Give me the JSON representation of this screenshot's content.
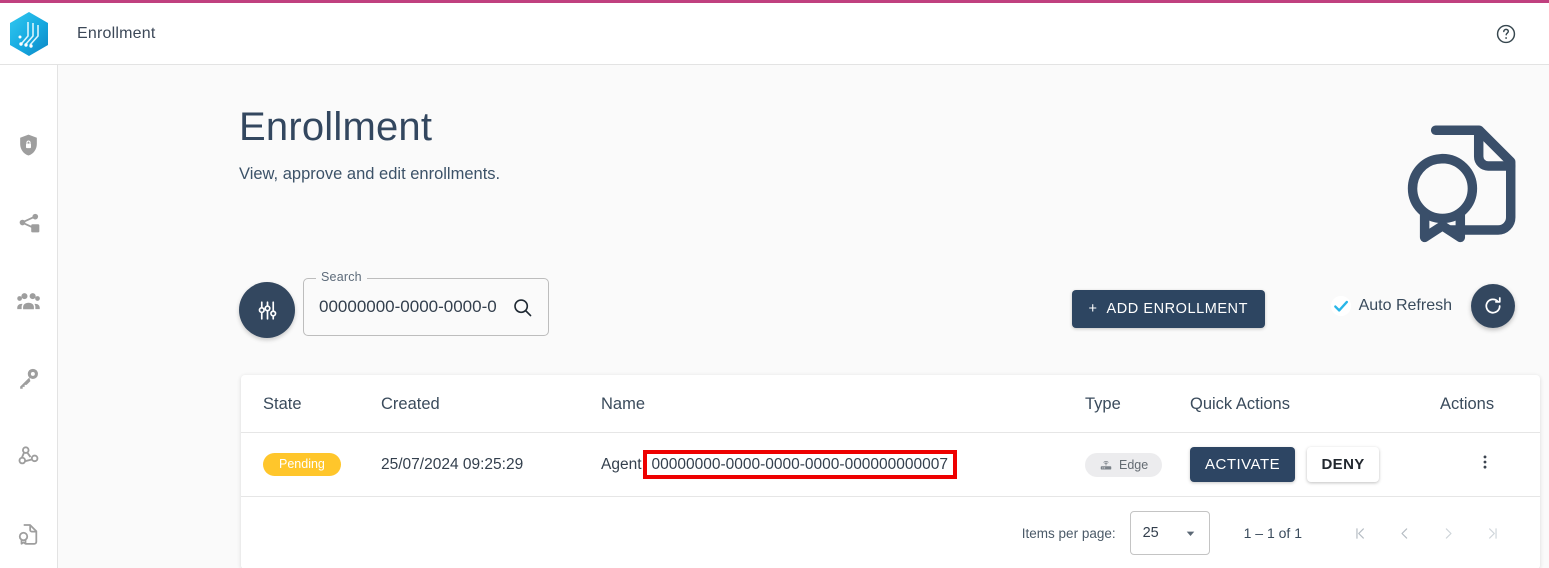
{
  "header": {
    "app_title": "Enrollment",
    "logo_icon": "hexagon-circuit-logo",
    "help_icon": "help-circle-icon"
  },
  "sidebar": {
    "items": [
      {
        "icon": "shield-lock-icon",
        "name": "security"
      },
      {
        "icon": "share-network-icon",
        "name": "network"
      },
      {
        "icon": "users-group-icon",
        "name": "users"
      },
      {
        "icon": "key-icon",
        "name": "keys"
      },
      {
        "icon": "webhook-icon",
        "name": "webhooks"
      },
      {
        "icon": "certificate-document-icon",
        "name": "enrollment"
      }
    ]
  },
  "page": {
    "title": "Enrollment",
    "subtitle": "View, approve and edit enrollments.",
    "hero_icon": "certificate-document-icon"
  },
  "toolbar": {
    "filter_icon": "tune-sliders-icon",
    "search": {
      "label": "Search",
      "value": "00000000-0000-0000-0",
      "placeholder": "Search",
      "icon": "search-icon"
    },
    "add_button": {
      "label": "ADD ENROLLMENT",
      "plus": "+"
    },
    "auto_refresh": {
      "label": "Auto Refresh",
      "checked": true,
      "check_color": "#29b6e8"
    },
    "refresh_icon": "refresh-icon"
  },
  "table": {
    "columns": [
      "State",
      "Created",
      "Name",
      "Type",
      "Quick Actions",
      "Actions"
    ],
    "rows": [
      {
        "state": "Pending",
        "state_color": "#ffc62b",
        "created": "25/07/2024 09:25:29",
        "name_prefix": "Agent",
        "name_uuid": "00000000-0000-0000-0000-000000000007",
        "type": "Edge",
        "type_icon": "edge-router-icon",
        "activate_label": "ACTIVATE",
        "deny_label": "DENY",
        "menu_icon": "kebab-menu-icon"
      }
    ]
  },
  "paginator": {
    "items_per_page_label": "Items per page:",
    "items_per_page_value": "25",
    "range_label": "1 – 1 of 1",
    "first_icon": "first-page-icon",
    "prev_icon": "prev-page-icon",
    "next_icon": "next-page-icon",
    "last_icon": "last-page-icon"
  },
  "colors": {
    "accent_top_bar": "#c0407f",
    "primary_navy": "#33475f",
    "pending_yellow": "#ffc62b",
    "highlight_red": "#ee0000",
    "logo_cyan": "#18b8e8"
  }
}
